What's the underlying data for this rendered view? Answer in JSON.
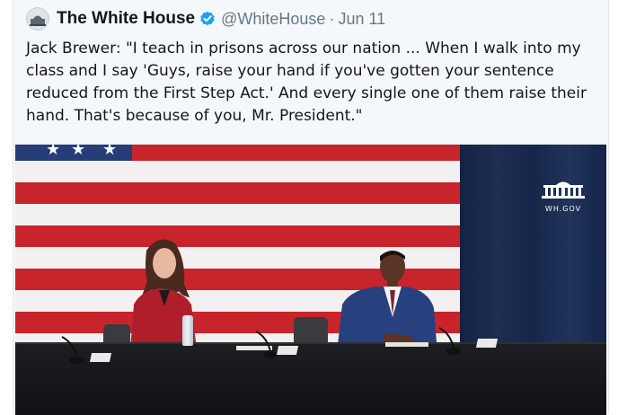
{
  "tweet": {
    "display_name": "The White House",
    "handle": "@WhiteHouse",
    "separator": "·",
    "date": "Jun 11",
    "text": "Jack Brewer: \"I teach in prisons across our nation ... When I walk into my class and I say 'Guys, raise your hand if you've gotten your sentence reduced from the First Step Act.' And every single one of them raise their hand. That's because of you, Mr. President.\""
  },
  "media": {
    "watermark_text": "WH.GOV"
  },
  "colors": {
    "verified_badge": "#1da1f2",
    "flag_red": "#c8242c",
    "flag_blue": "#263d78",
    "curtain": "#1b2a4a"
  }
}
